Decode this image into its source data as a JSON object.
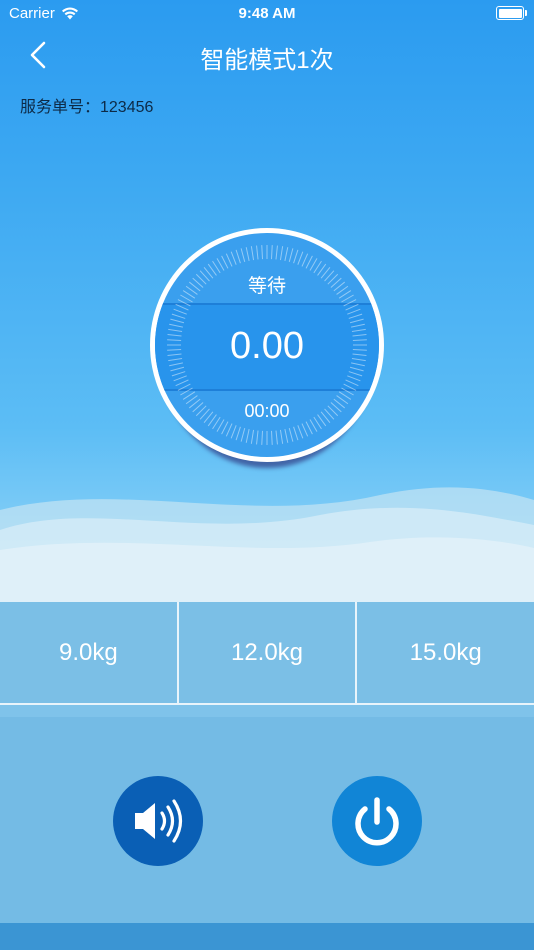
{
  "status_bar": {
    "carrier": "Carrier",
    "time": "9:48 AM"
  },
  "nav": {
    "title": "智能模式1次"
  },
  "order": {
    "label": "服务单号：123456"
  },
  "dial": {
    "status": "等待",
    "value": "0.00",
    "timer": "00:00"
  },
  "weights": [
    "9.0kg",
    "12.0kg",
    "15.0kg"
  ],
  "icons": {
    "back": "chevron-left-icon",
    "sound": "speaker-icon",
    "power": "power-icon"
  },
  "colors": {
    "primary": "#2894ec",
    "sound_button": "#0a5fb5",
    "power_button": "#1185d6"
  }
}
